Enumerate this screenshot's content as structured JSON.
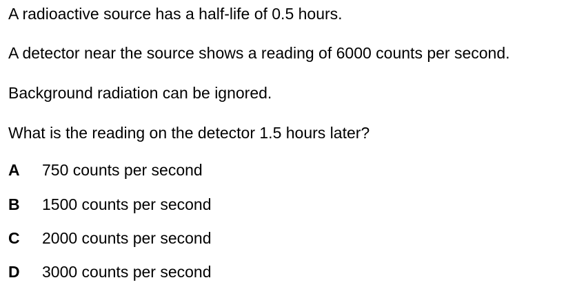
{
  "question": {
    "stem_lines": [
      "A radioactive source has a half-life of 0.5 hours.",
      "A detector near the source shows a reading of 6000 counts per second.",
      "Background radiation can be ignored.",
      "What is the reading on the detector 1.5 hours later?"
    ],
    "options": [
      {
        "letter": "A",
        "text": "750 counts per second"
      },
      {
        "letter": "B",
        "text": "1500 counts per second"
      },
      {
        "letter": "C",
        "text": "2000 counts per second"
      },
      {
        "letter": "D",
        "text": "3000 counts per second"
      }
    ]
  }
}
